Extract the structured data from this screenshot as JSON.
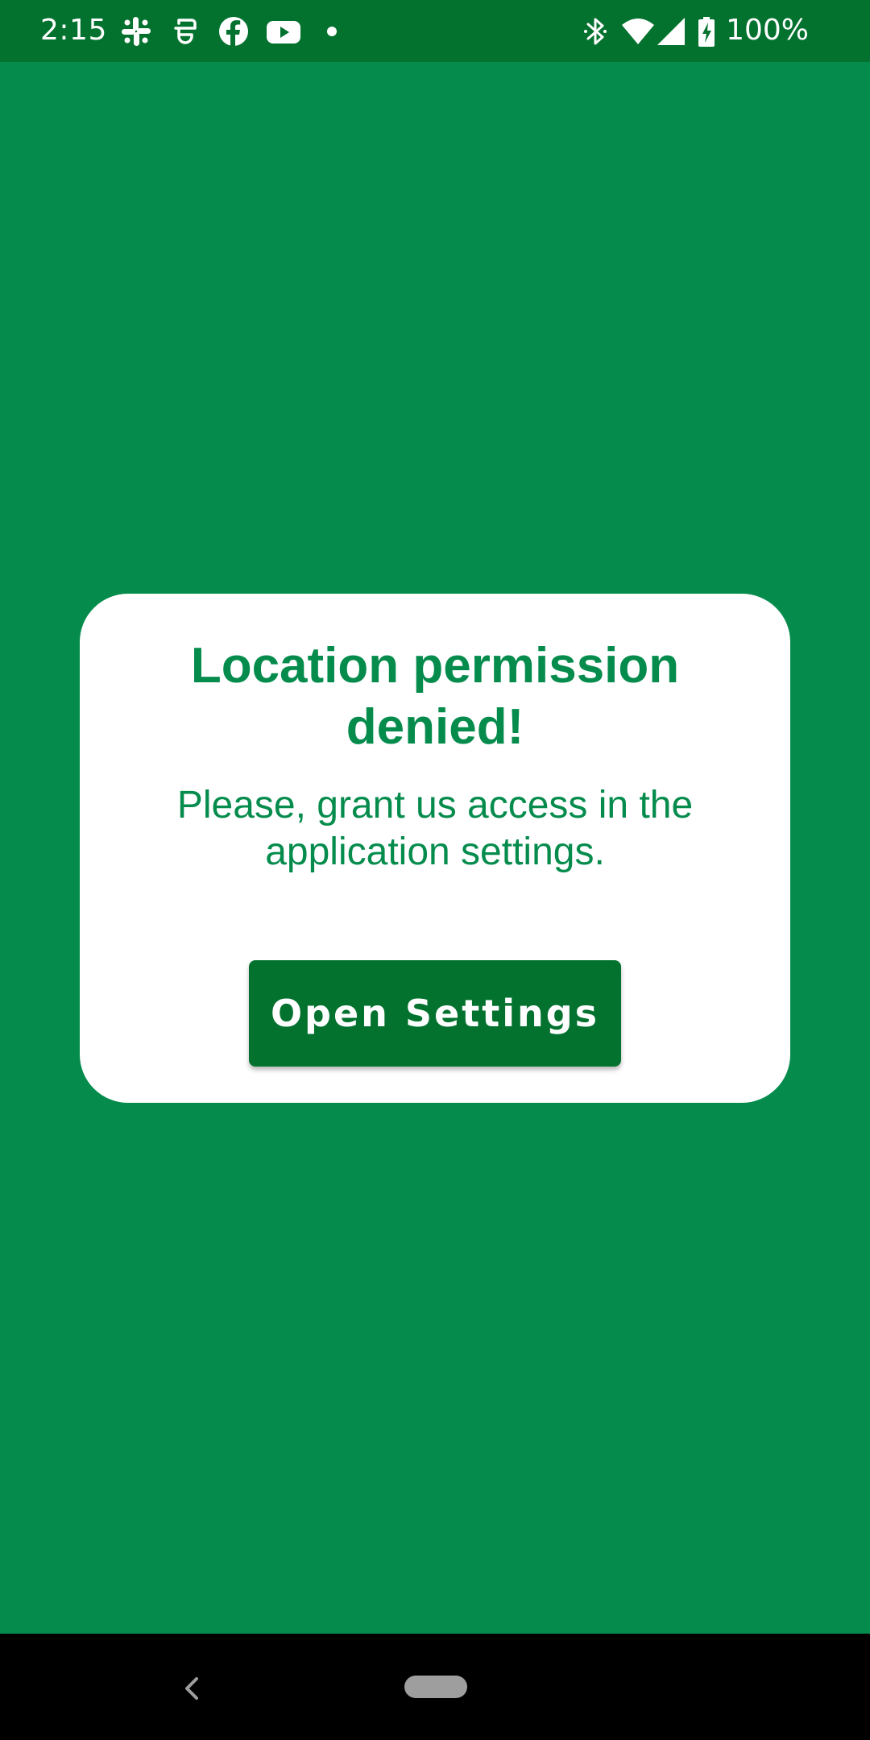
{
  "status_bar": {
    "time": "2:15",
    "battery_percent": "100%",
    "notification_icons": [
      "slack-icon",
      "face-app-icon",
      "facebook-icon",
      "youtube-icon",
      "more-notifications-dot-icon"
    ],
    "system_icons": [
      "bluetooth-icon",
      "wifi-icon",
      "cell-signal-icon",
      "battery-charging-icon"
    ]
  },
  "dialog": {
    "title": "Location permission denied!",
    "message": "Please, grant us access in the application settings.",
    "button_label": "Open Settings"
  },
  "nav_bar": {
    "icons": [
      "back-icon",
      "home-pill"
    ]
  },
  "colors": {
    "background": "#058C4D",
    "status_bar": "#03722F",
    "card": "#FFFFFF",
    "accent_text": "#058C4D",
    "button": "#03722F",
    "nav_bar": "#000000"
  }
}
